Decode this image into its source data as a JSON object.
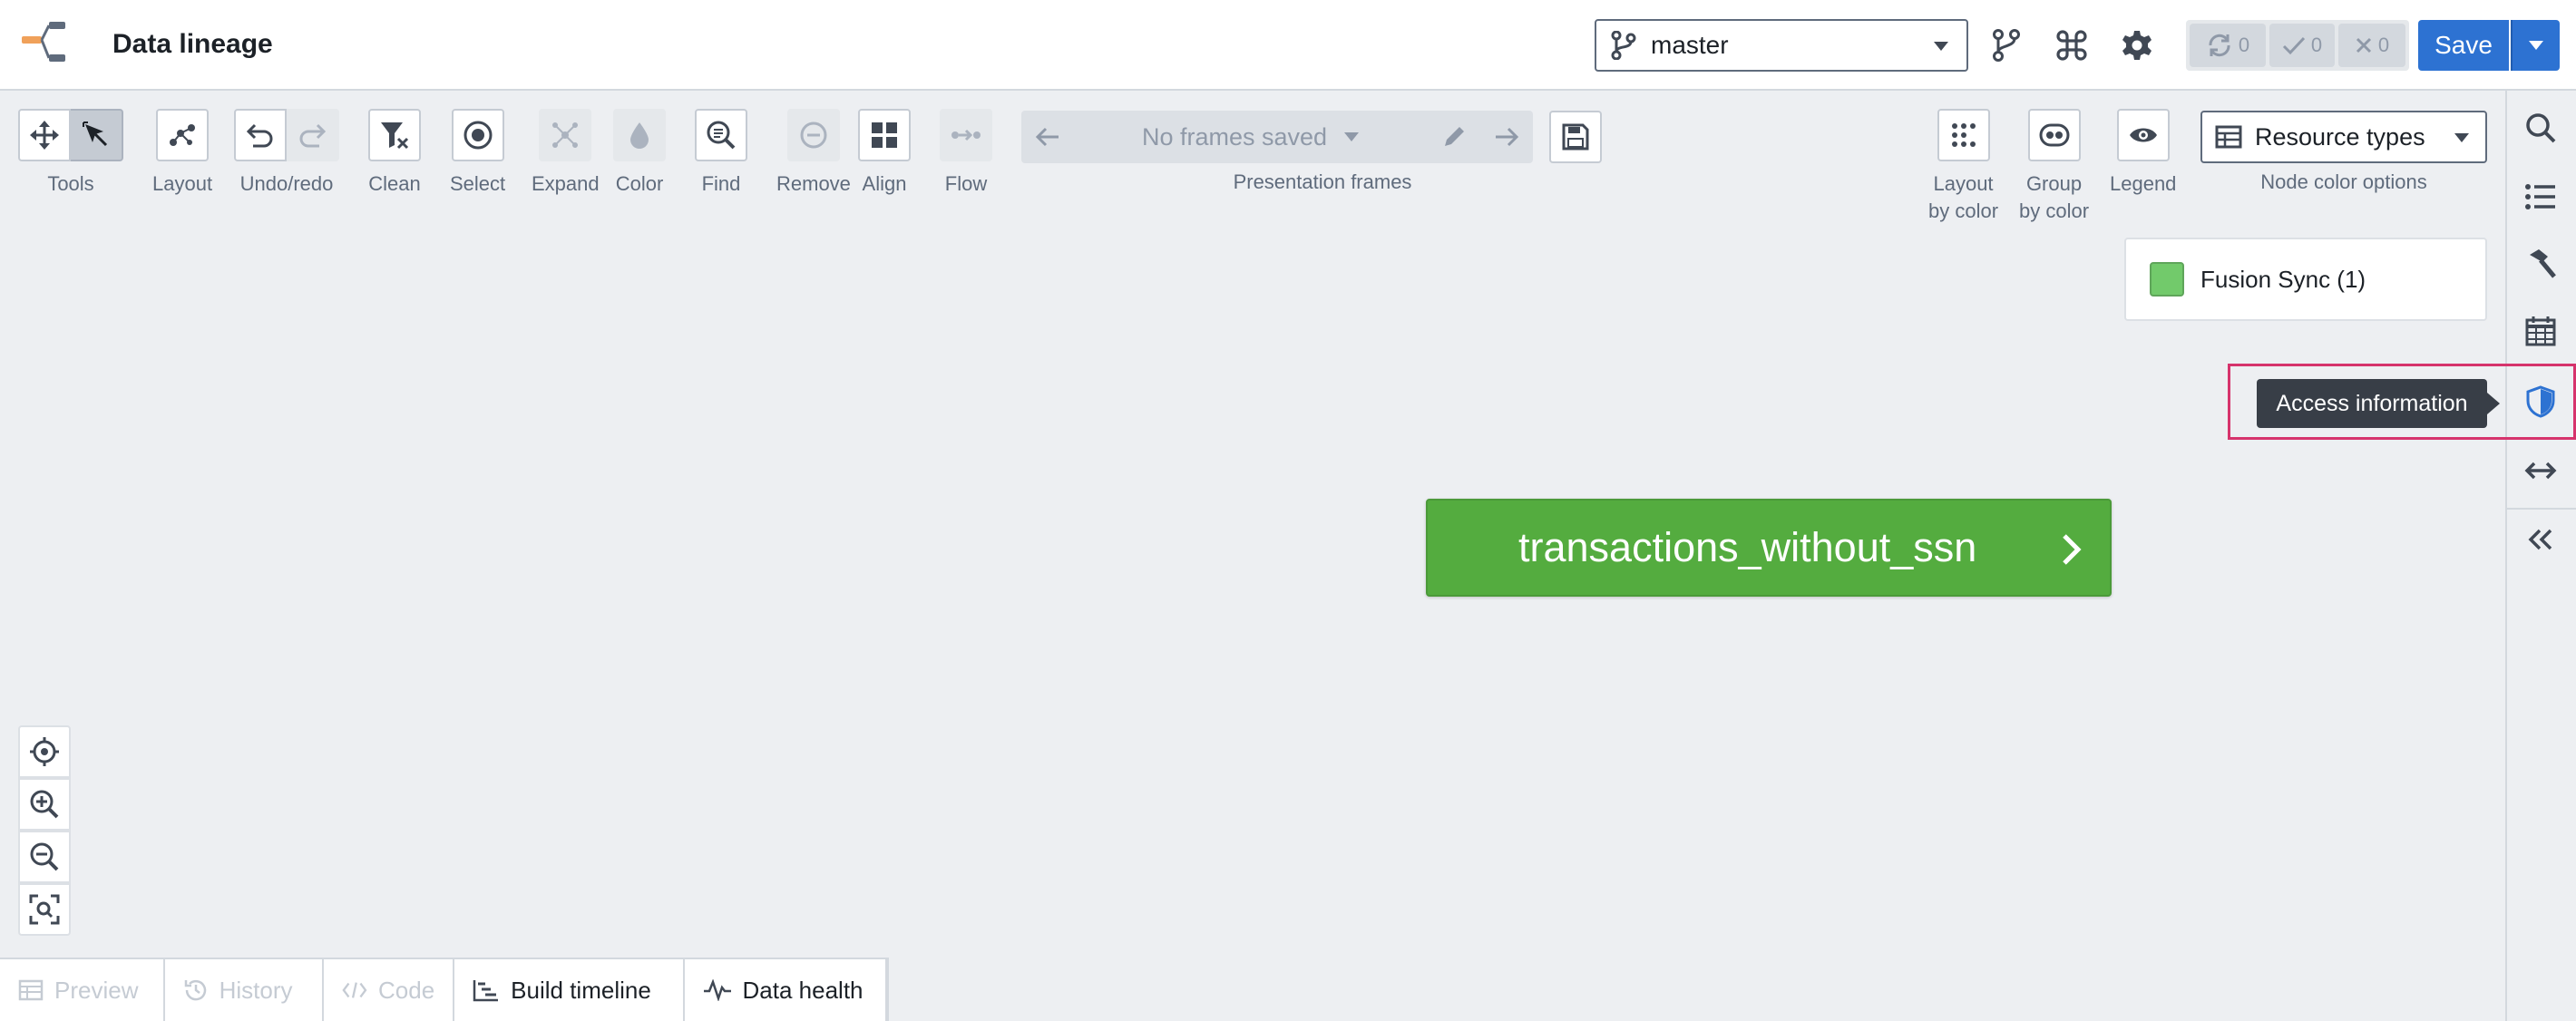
{
  "header": {
    "title": "Data lineage",
    "branch": "master",
    "status": {
      "sync_count": "0",
      "success_count": "0",
      "error_count": "0"
    },
    "save_label": "Save"
  },
  "toolbar": {
    "tools": "Tools",
    "layout": "Layout",
    "undo_redo": "Undo/redo",
    "clean": "Clean",
    "select": "Select",
    "expand": "Expand",
    "color": "Color",
    "find": "Find",
    "remove": "Remove",
    "align": "Align",
    "flow": "Flow",
    "frames_value": "No frames saved",
    "frames_label": "Presentation frames",
    "layout_by_color_1": "Layout",
    "layout_by_color_2": "by color",
    "group_by_color_1": "Group",
    "group_by_color_2": "by color",
    "legend": "Legend",
    "node_color_value": "Resource types",
    "node_color_label": "Node color options"
  },
  "legend": {
    "items": [
      {
        "label": "Fusion Sync (1)",
        "color": "#72ca6b"
      }
    ]
  },
  "graph": {
    "nodes": [
      {
        "label": "transactions_without_ssn",
        "color": "#54ac3f"
      }
    ]
  },
  "tooltip": {
    "text": "Access information"
  },
  "bottom_tabs": [
    {
      "label": "Preview",
      "disabled": true
    },
    {
      "label": "History",
      "disabled": true
    },
    {
      "label": "Code",
      "disabled": true
    },
    {
      "label": "Build timeline",
      "disabled": false
    },
    {
      "label": "Data health",
      "disabled": false
    }
  ],
  "colors": {
    "accent": "#2d72d2",
    "highlight": "#d6336c",
    "node_green": "#54ac3f"
  }
}
